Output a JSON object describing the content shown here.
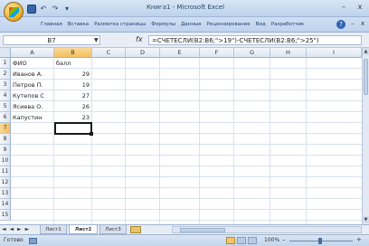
{
  "window": {
    "title": "Книга1 - Microsoft Excel",
    "minimize_label": "–",
    "close_label": "x"
  },
  "quick_access": {
    "undo_label": "↶",
    "redo_label": "↷",
    "customize_label": "▾"
  },
  "ribbon": {
    "tabs": [
      "Главная",
      "Вставка",
      "Разметка страницы",
      "Формулы",
      "Данные",
      "Рецензирование",
      "Вид",
      "Разработчик"
    ],
    "help_label": "?",
    "minimize_label": "–",
    "close_label": "x"
  },
  "formula_bar": {
    "name_box": "B7",
    "fx_label": "fx",
    "formula": "=СЧЕТЕСЛИ(B2:B6;\">19\")-СЧЕТЕСЛИ(B2:B6;\">25\")"
  },
  "sheet": {
    "columns": [
      "A",
      "B",
      "C",
      "D",
      "E",
      "F",
      "G",
      "H",
      "I"
    ],
    "rows": [
      "1",
      "2",
      "3",
      "4",
      "5",
      "6",
      "7",
      "8",
      "9",
      "10",
      "11",
      "12",
      "13",
      "14",
      "15"
    ],
    "cells": {
      "A1": "ФИО",
      "B1": "балл",
      "A2": "Иванов А.",
      "B2": "29",
      "A3": "Петров П.",
      "B3": "19",
      "A4": "Кутепов С",
      "B4": "27",
      "A5": "Ясиева О.",
      "B5": "26",
      "A6": "Капустин",
      "B6": "23"
    },
    "active_cell": "B7"
  },
  "sheet_tabs": {
    "nav_label": "◄ ◄ ► ►",
    "tabs": [
      "Лист1",
      "Лист2",
      "Лист3"
    ],
    "active": "Лист2"
  },
  "status_bar": {
    "status_text": "Готово",
    "zoom": "100%",
    "zoom_minus": "–",
    "zoom_plus": "+"
  },
  "colors": {
    "accent": "#3a66a8",
    "selected_header": "#f3be5d",
    "ribbon_bg": "#cfdff3"
  }
}
